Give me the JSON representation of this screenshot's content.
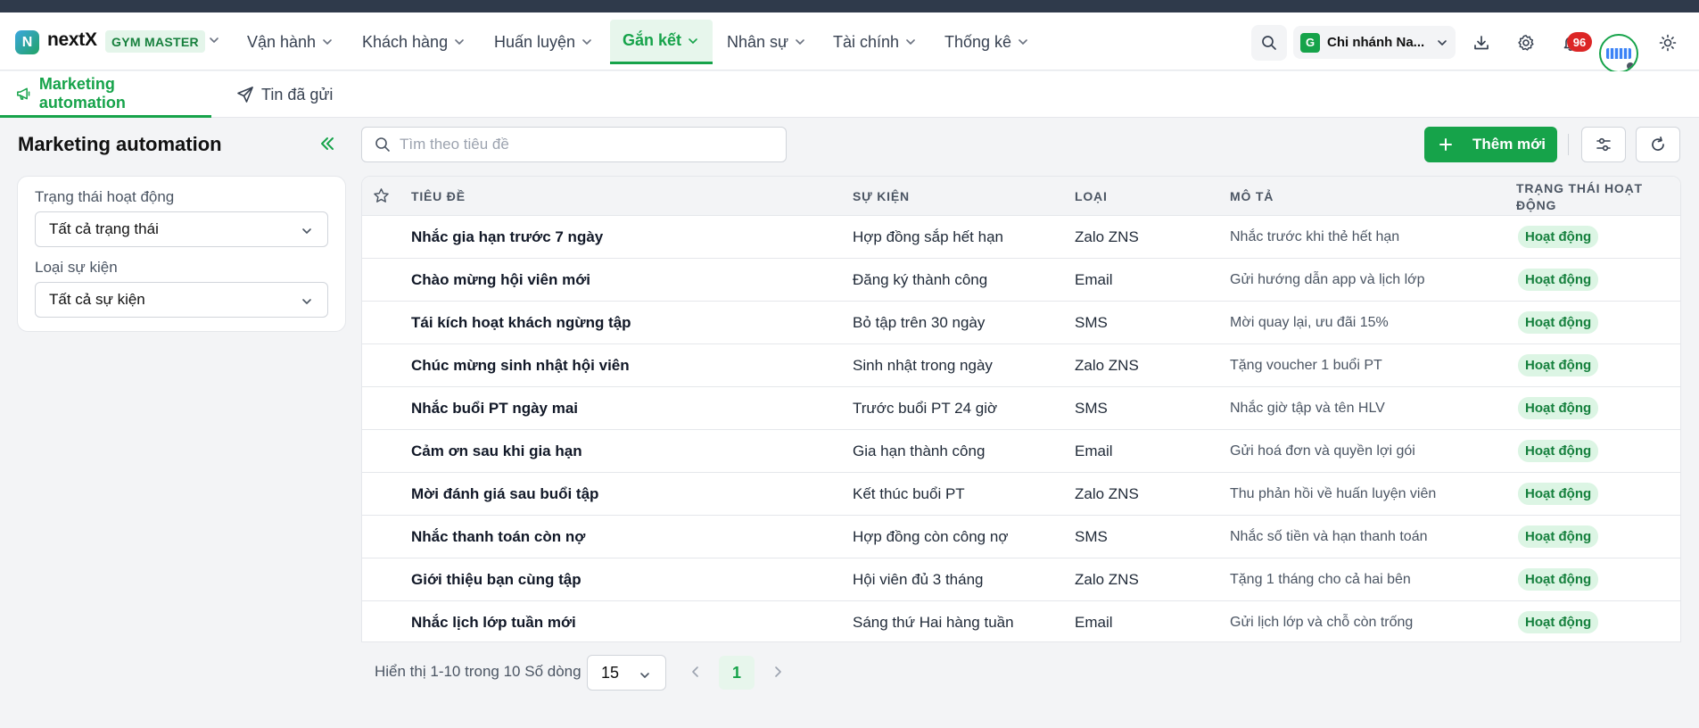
{
  "app": {
    "logo_letter": "N",
    "name": "nextX",
    "product_badge": "GYM MASTER"
  },
  "nav": {
    "items": [
      {
        "label": "Vận hành"
      },
      {
        "label": "Khách hàng"
      },
      {
        "label": "Huấn luyện"
      },
      {
        "label": "Gắn kết"
      },
      {
        "label": "Nhân sự"
      },
      {
        "label": "Tài chính"
      },
      {
        "label": "Thống kê"
      }
    ],
    "active_index": 3
  },
  "header": {
    "branch_letter": "G",
    "branch_name": "Chi nhánh Na...",
    "notification_count": "96",
    "icons": [
      "search-icon",
      "download-icon",
      "gear-icon",
      "bell-icon",
      "sun-icon"
    ]
  },
  "subtabs": [
    {
      "label": "Marketing automation",
      "icon": "megaphone-icon"
    },
    {
      "label": "Tin đã gửi",
      "icon": "send-icon"
    }
  ],
  "sidebar": {
    "title": "Marketing automation",
    "filters": [
      {
        "label": "Trạng thái hoạt động",
        "value": "Tất cả trạng thái"
      },
      {
        "label": "Loại sự kiện",
        "value": "Tất cả sự kiện"
      }
    ]
  },
  "toolbar": {
    "search_placeholder": "Tìm theo tiêu đề",
    "add_label": "Thêm mới"
  },
  "table": {
    "columns": [
      "Tiêu đề",
      "Sự kiện",
      "Loại",
      "Mô tả",
      "Trạng thái hoạt động"
    ],
    "rows": [
      {
        "title": "Nhắc gia hạn trước 7 ngày",
        "event": "Hợp đồng sắp hết hạn",
        "type": "Zalo ZNS",
        "desc": "Nhắc trước khi thẻ hết hạn",
        "status": "Hoạt động"
      },
      {
        "title": "Chào mừng hội viên mới",
        "event": "Đăng ký thành công",
        "type": "Email",
        "desc": "Gửi hướng dẫn app và lịch lớp",
        "status": "Hoạt động"
      },
      {
        "title": "Tái kích hoạt khách ngừng tập",
        "event": "Bỏ tập trên 30 ngày",
        "type": "SMS",
        "desc": "Mời quay lại, ưu đãi 15%",
        "status": "Hoạt động"
      },
      {
        "title": "Chúc mừng sinh nhật hội viên",
        "event": "Sinh nhật trong ngày",
        "type": "Zalo ZNS",
        "desc": "Tặng voucher 1 buổi PT",
        "status": "Hoạt động"
      },
      {
        "title": "Nhắc buổi PT ngày mai",
        "event": "Trước buổi PT 24 giờ",
        "type": "SMS",
        "desc": "Nhắc giờ tập và tên HLV",
        "status": "Hoạt động"
      },
      {
        "title": "Cảm ơn sau khi gia hạn",
        "event": "Gia hạn thành công",
        "type": "Email",
        "desc": "Gửi hoá đơn và quyền lợi gói",
        "status": "Hoạt động"
      },
      {
        "title": "Mời đánh giá sau buổi tập",
        "event": "Kết thúc buổi PT",
        "type": "Zalo ZNS",
        "desc": "Thu phản hồi về huấn luyện viên",
        "status": "Hoạt động"
      },
      {
        "title": "Nhắc thanh toán còn nợ",
        "event": "Hợp đồng còn công nợ",
        "type": "SMS",
        "desc": "Nhắc số tiền và hạn thanh toán",
        "status": "Hoạt động"
      },
      {
        "title": "Giới thiệu bạn cùng tập",
        "event": "Hội viên đủ 3 tháng",
        "type": "Zalo ZNS",
        "desc": "Tặng 1 tháng cho cả hai bên",
        "status": "Hoạt động"
      },
      {
        "title": "Nhắc lịch lớp tuần mới",
        "event": "Sáng thứ Hai hàng tuần",
        "type": "Email",
        "desc": "Gửi lịch lớp và chỗ còn trống",
        "status": "Hoạt động"
      }
    ]
  },
  "pagination": {
    "summary": "Hiển thị 1-10 trong 10",
    "rows_label": "Số dòng",
    "page_size": "15",
    "current_page": "1"
  },
  "colors": {
    "accent": "#16a34a",
    "accent_light": "#e7f6ec",
    "badge_red": "#dc2626",
    "topbar_dark": "#2f3a4b"
  }
}
